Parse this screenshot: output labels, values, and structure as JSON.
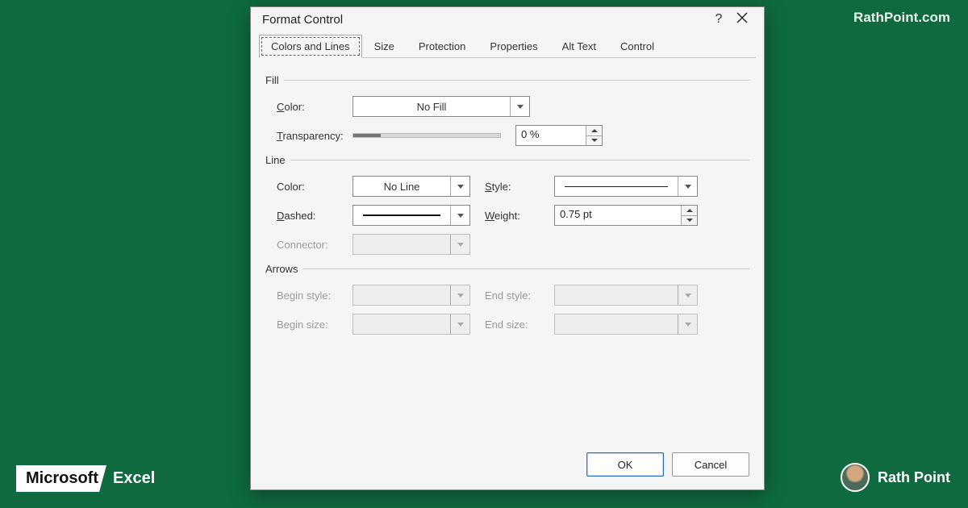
{
  "branding": {
    "url": "RathPoint.com",
    "watermark": "Rath Point",
    "watermark2": "Rath Point",
    "ms": "Microsoft",
    "product": "Excel",
    "author": "Rath Point"
  },
  "dialog": {
    "title": "Format Control",
    "tabs": [
      "Colors and Lines",
      "Size",
      "Protection",
      "Properties",
      "Alt Text",
      "Control"
    ],
    "active_tab": 0,
    "sections": {
      "fill": {
        "label": "Fill",
        "color_label": "Color:",
        "color_value": "No Fill",
        "transparency_label": "Transparency:",
        "transparency_value": "0 %"
      },
      "line": {
        "label": "Line",
        "color_label": "Color:",
        "color_value": "No Line",
        "style_label": "Style:",
        "dashed_label": "Dashed:",
        "weight_label": "Weight:",
        "weight_value": "0.75 pt",
        "connector_label": "Connector:"
      },
      "arrows": {
        "label": "Arrows",
        "begin_style_label": "Begin style:",
        "end_style_label": "End style:",
        "begin_size_label": "Begin size:",
        "end_size_label": "End size:"
      }
    },
    "buttons": {
      "ok": "OK",
      "cancel": "Cancel"
    }
  }
}
